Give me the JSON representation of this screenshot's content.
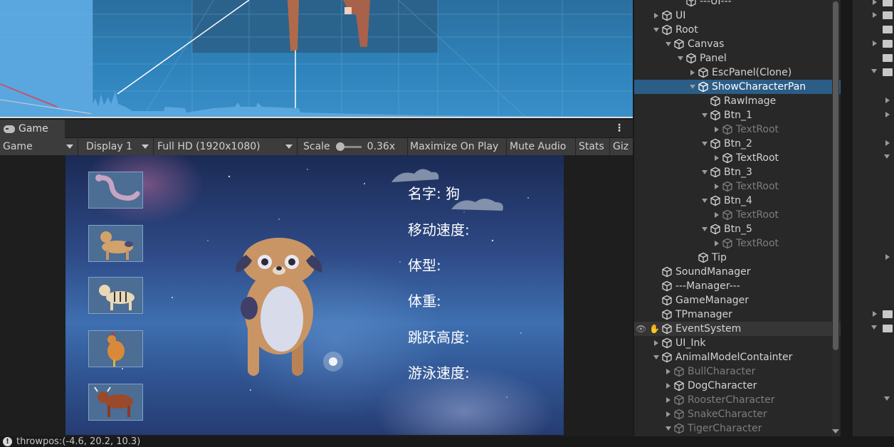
{
  "game_panel": {
    "tab_label": "Game",
    "toolbar": {
      "view_select": "Game",
      "display_select": "Display 1",
      "resolution_select": "Full HD (1920x1080)",
      "scale_label": "Scale",
      "scale_value": "0.36x",
      "scale_fraction": 0.0,
      "maximize_label": "Maximize On Play",
      "mute_label": "Mute Audio",
      "stats_label": "Stats",
      "gizmos_label": "Giz"
    },
    "game_view": {
      "info": {
        "name": "名字: 狗",
        "move_speed": "移动速度:",
        "body_type": "体型:",
        "weight": "体重:",
        "jump_height": "跳跃高度:",
        "swim_speed": "游泳速度:"
      },
      "thumbnails": [
        "snake",
        "dog",
        "tiger",
        "rooster",
        "bull"
      ]
    }
  },
  "hierarchy": {
    "rows": [
      {
        "label": "---UI---",
        "fold": "none",
        "state": "normal"
      },
      {
        "label": "UI",
        "fold": "right",
        "state": "normal"
      },
      {
        "label": "Root",
        "fold": "down",
        "state": "normal"
      },
      {
        "label": "Canvas",
        "fold": "down",
        "state": "normal"
      },
      {
        "label": "Panel",
        "fold": "down",
        "state": "normal"
      },
      {
        "label": "EscPanel(Clone)",
        "fold": "right",
        "state": "normal"
      },
      {
        "label": "ShowCharacterPan",
        "fold": "down",
        "state": "selected"
      },
      {
        "label": "RawImage",
        "fold": "none",
        "state": "normal"
      },
      {
        "label": "Btn_1",
        "fold": "down",
        "state": "normal"
      },
      {
        "label": "TextRoot",
        "fold": "right",
        "state": "dim"
      },
      {
        "label": "Btn_2",
        "fold": "down",
        "state": "normal"
      },
      {
        "label": "TextRoot",
        "fold": "right",
        "state": "normal"
      },
      {
        "label": "Btn_3",
        "fold": "down",
        "state": "normal"
      },
      {
        "label": "TextRoot",
        "fold": "right",
        "state": "dim"
      },
      {
        "label": "Btn_4",
        "fold": "down",
        "state": "normal"
      },
      {
        "label": "TextRoot",
        "fold": "right",
        "state": "dim"
      },
      {
        "label": "Btn_5",
        "fold": "down",
        "state": "normal"
      },
      {
        "label": "TextRoot",
        "fold": "right",
        "state": "dim"
      },
      {
        "label": "Tip",
        "fold": "none",
        "state": "normal"
      },
      {
        "label": "SoundManager",
        "fold": "none",
        "state": "normal"
      },
      {
        "label": "---Manager---",
        "fold": "none",
        "state": "normal"
      },
      {
        "label": "GameManager",
        "fold": "none",
        "state": "normal"
      },
      {
        "label": "TPmanager",
        "fold": "none",
        "state": "normal"
      },
      {
        "label": "EventSystem",
        "fold": "none",
        "state": "hover"
      },
      {
        "label": "UI_Ink",
        "fold": "right",
        "state": "normal"
      },
      {
        "label": "AnimalModelContainter",
        "fold": "down",
        "state": "normal"
      },
      {
        "label": "BullCharacter",
        "fold": "right",
        "state": "dim"
      },
      {
        "label": "DogCharacter",
        "fold": "right",
        "state": "normal"
      },
      {
        "label": "RoosterCharacter",
        "fold": "right",
        "state": "dim"
      },
      {
        "label": "SnakeCharacter",
        "fold": "right",
        "state": "dim"
      },
      {
        "label": "TigerCharacter",
        "fold": "down",
        "state": "dim"
      }
    ]
  },
  "console": {
    "status_text": "throwpos:(-4.6, 20.2, 10.3)"
  },
  "colors": {
    "selection": "#2c5d87",
    "panel_bg": "#282828",
    "toolbar_bg": "#3c3c3c"
  }
}
